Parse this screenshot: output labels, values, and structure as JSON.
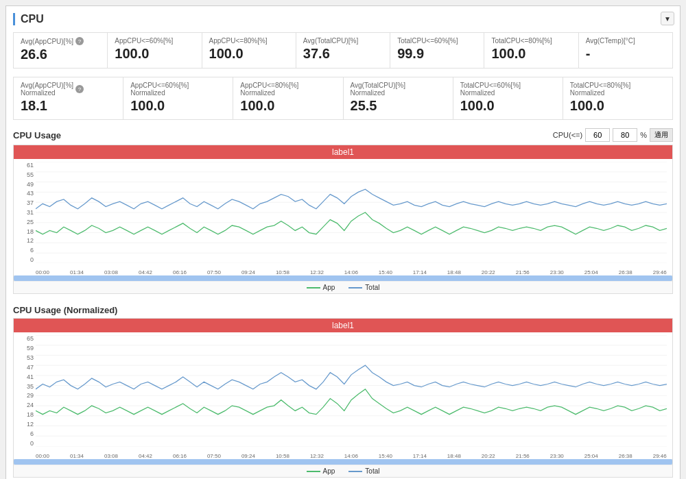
{
  "panel": {
    "title": "CPU",
    "expand_icon": "▼"
  },
  "metrics": {
    "row1": [
      {
        "label": "Avg(AppCPU)[%]",
        "has_info": true,
        "value": "26.6"
      },
      {
        "label": "AppCPU<=60%[%]",
        "has_info": false,
        "value": "100.0"
      },
      {
        "label": "AppCPU<=80%[%]",
        "has_info": false,
        "value": "100.0"
      },
      {
        "label": "Avg(TotalCPU)[%]",
        "has_info": false,
        "value": "37.6"
      },
      {
        "label": "TotalCPU<=60%[%]",
        "has_info": false,
        "value": "99.9"
      },
      {
        "label": "TotalCPU<=80%[%]",
        "has_info": false,
        "value": "100.0"
      },
      {
        "label": "Avg(CTemp)[°C]",
        "has_info": false,
        "value": "-"
      }
    ],
    "row2": [
      {
        "label": "Avg(AppCPU)[%] Normalized",
        "has_info": true,
        "value": "18.1"
      },
      {
        "label": "AppCPU<=60%[%] Normalized",
        "has_info": false,
        "value": "100.0"
      },
      {
        "label": "AppCPU<=80%[%] Normalized",
        "has_info": false,
        "value": "100.0"
      },
      {
        "label": "Avg(TotalCPU)[%] Normalized",
        "has_info": false,
        "value": "25.5"
      },
      {
        "label": "TotalCPU<=60%[%] Normalized",
        "has_info": false,
        "value": "100.0"
      },
      {
        "label": "TotalCPU<=80%[%] Normalized",
        "has_info": false,
        "value": "100.0"
      }
    ]
  },
  "chart1": {
    "title": "CPU Usage",
    "label_bar": "label1",
    "controls": {
      "prefix": "CPU(<=)",
      "val1": "60",
      "val2": "80",
      "suffix": "%",
      "apply_label": "適用"
    },
    "y_axis": [
      "61",
      "55",
      "49",
      "43",
      "37",
      "31",
      "25",
      "18",
      "12",
      "6",
      "0"
    ],
    "x_axis": [
      "00:00",
      "01:34",
      "03:08",
      "04:42",
      "06:16",
      "07:50",
      "09:24",
      "10:58",
      "12:32",
      "14:06",
      "15:40",
      "17:14",
      "18:48",
      "20:22",
      "21:56",
      "23:30",
      "25:04",
      "26:38",
      "29:46"
    ],
    "legend": [
      {
        "color": "#4dbb6d",
        "label": "App"
      },
      {
        "color": "#6699cc",
        "label": "Total"
      }
    ]
  },
  "chart2": {
    "title": "CPU Usage (Normalized)",
    "label_bar": "label1",
    "y_axis": [
      "65",
      "59",
      "53",
      "47",
      "41",
      "35",
      "29",
      "24",
      "18",
      "12",
      "6",
      "0"
    ],
    "x_axis": [
      "00:00",
      "01:34",
      "03:08",
      "04:42",
      "06:16",
      "07:50",
      "09:24",
      "10:58",
      "12:32",
      "14:06",
      "15:40",
      "17:14",
      "18:48",
      "20:22",
      "21:56",
      "23:30",
      "25:04",
      "26:38",
      "29:46"
    ],
    "legend": [
      {
        "color": "#4dbb6d",
        "label": "App"
      },
      {
        "color": "#6699cc",
        "label": "Total"
      }
    ]
  }
}
